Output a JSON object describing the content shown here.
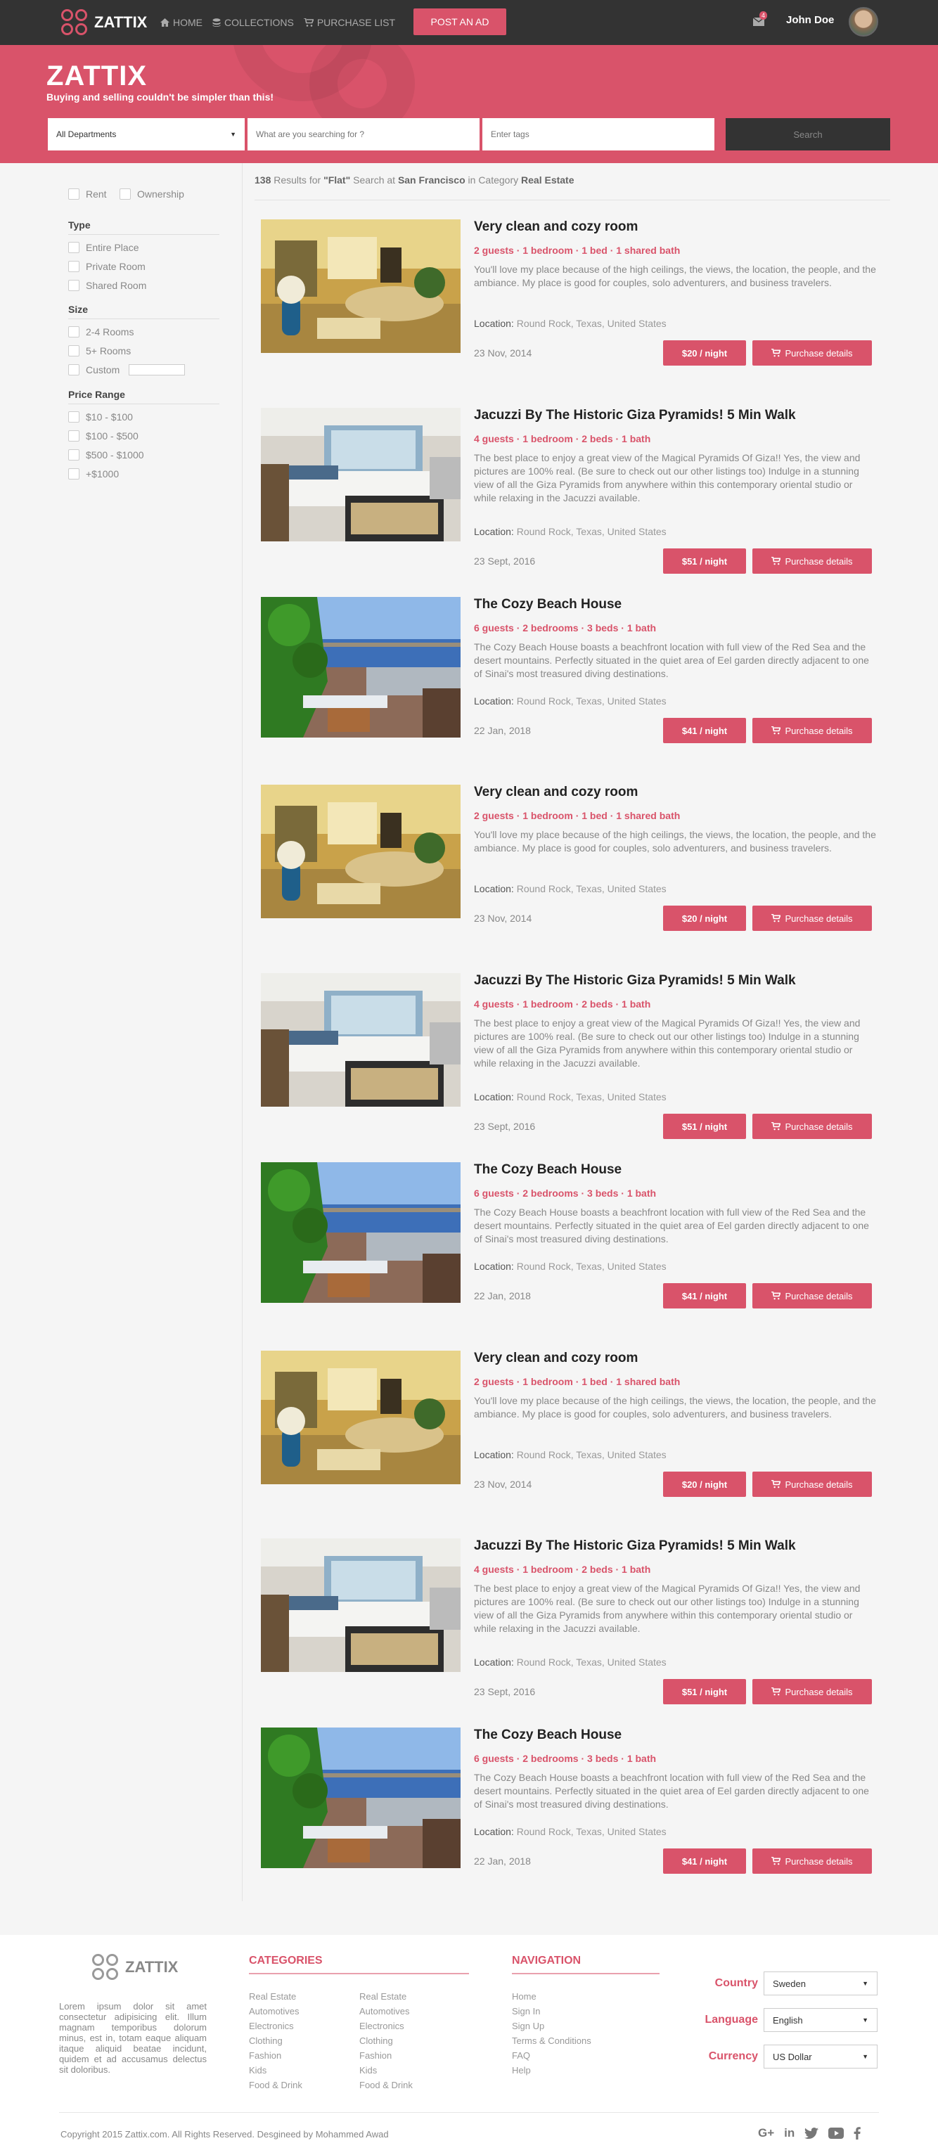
{
  "header": {
    "brand": "ZATTIX",
    "nav": [
      {
        "label": "HOME",
        "icon": "home-icon"
      },
      {
        "label": "COLLECTIONS",
        "icon": "stack-icon"
      },
      {
        "label": "PURCHASE LIST",
        "icon": "cart-icon"
      }
    ],
    "post_ad_label": "POST AN AD",
    "mail_badge": "4",
    "user_name": "John Doe"
  },
  "hero": {
    "title": "ZATTIX",
    "subtitle": "Buying and selling couldn't be simpler than this!",
    "department_value": "All Departments",
    "search_placeholder": "What are you searching for ?",
    "tags_placeholder": "Enter tags",
    "search_label": "Search"
  },
  "filters": {
    "listing": [
      "Rent",
      "Ownership"
    ],
    "type_heading": "Type",
    "types": [
      "Entire Place",
      "Private Room",
      "Shared Room"
    ],
    "size_heading": "Size",
    "sizes": [
      "2-4 Rooms",
      "5+ Rooms",
      "Custom"
    ],
    "price_heading": "Price Range",
    "prices": [
      "$10 - $100",
      "$100 - $500",
      "$500 - $1000",
      "+$1000"
    ]
  },
  "results": {
    "count": "138",
    "text1": " Results for ",
    "query": "\"Flat\"",
    "text2": " Search at ",
    "city": "San Francisco",
    "text3": " in Category ",
    "category": "Real Estate"
  },
  "listings": [
    {
      "title": "Very clean and cozy room",
      "meta": "2 guests · 1 bedroom · 1 bed · 1 shared bath",
      "desc": "You'll love my place because of the high ceilings, the views, the location, the people, and the ambiance. My place is good for couples, solo adventurers, and business travelers.",
      "location_label": "Location:",
      "location": "Round Rock, Texas, United States",
      "date": "23 Nov, 2014",
      "price": "$20 / night",
      "details_label": "Purchase details",
      "photo": "room"
    },
    {
      "title": "Jacuzzi By The Historic Giza Pyramids! 5 Min Walk",
      "meta": "4 guests · 1 bedroom · 2 beds · 1 bath",
      "desc": "The best place to enjoy a great view of the Magical Pyramids Of Giza!! Yes, the view and pictures are 100% real. (Be sure to check out our other listings too) Indulge in a stunning view of all the Giza Pyramids from anywhere within this contemporary oriental studio or while relaxing in the Jacuzzi available.",
      "location_label": "Location:",
      "location": "Round Rock, Texas, United States",
      "date": "23 Sept, 2016",
      "price": "$51 / night",
      "details_label": "Purchase details",
      "photo": "bedroom"
    },
    {
      "title": "The Cozy Beach House",
      "meta": "6 guests · 2 bedrooms · 3 beds · 1 bath",
      "desc": "The Cozy Beach House boasts a beachfront location with full view of the Red Sea and the desert mountains. Perfectly situated in the quiet area of Eel garden directly adjacent to one of Sinai's most treasured diving destinations.",
      "location_label": "Location:",
      "location": "Round Rock, Texas, United States",
      "date": "22 Jan, 2018",
      "price": "$41 / night",
      "details_label": "Purchase details",
      "photo": "beach"
    },
    {
      "title": "Very clean and cozy room",
      "meta": "2 guests · 1 bedroom · 1 bed · 1 shared bath",
      "desc": "You'll love my place because of the high ceilings, the views, the location, the people, and the ambiance. My place is good for couples, solo adventurers, and business travelers.",
      "location_label": "Location:",
      "location": "Round Rock, Texas, United States",
      "date": "23 Nov, 2014",
      "price": "$20 / night",
      "details_label": "Purchase details",
      "photo": "room"
    },
    {
      "title": "Jacuzzi By The Historic Giza Pyramids! 5 Min Walk",
      "meta": "4 guests · 1 bedroom · 2 beds · 1 bath",
      "desc": "The best place to enjoy a great view of the Magical Pyramids Of Giza!! Yes, the view and pictures are 100% real. (Be sure to check out our other listings too) Indulge in a stunning view of all the Giza Pyramids from anywhere within this contemporary oriental studio or while relaxing in the Jacuzzi available.",
      "location_label": "Location:",
      "location": "Round Rock, Texas, United States",
      "date": "23 Sept, 2016",
      "price": "$51 / night",
      "details_label": "Purchase details",
      "photo": "bedroom"
    },
    {
      "title": "The Cozy Beach House",
      "meta": "6 guests · 2 bedrooms · 3 beds · 1 bath",
      "desc": "The Cozy Beach House boasts a beachfront location with full view of the Red Sea and the desert mountains. Perfectly situated in the quiet area of Eel garden directly adjacent to one of Sinai's most treasured diving destinations.",
      "location_label": "Location:",
      "location": "Round Rock, Texas, United States",
      "date": "22 Jan, 2018",
      "price": "$41 / night",
      "details_label": "Purchase details",
      "photo": "beach"
    },
    {
      "title": "Very clean and cozy room",
      "meta": "2 guests · 1 bedroom · 1 bed · 1 shared bath",
      "desc": "You'll love my place because of the high ceilings, the views, the location, the people, and the ambiance. My place is good for couples, solo adventurers, and business travelers.",
      "location_label": "Location:",
      "location": "Round Rock, Texas, United States",
      "date": "23 Nov, 2014",
      "price": "$20 / night",
      "details_label": "Purchase details",
      "photo": "room"
    },
    {
      "title": "Jacuzzi By The Historic Giza Pyramids! 5 Min Walk",
      "meta": "4 guests · 1 bedroom · 2 beds · 1 bath",
      "desc": "The best place to enjoy a great view of the Magical Pyramids Of Giza!! Yes, the view and pictures are 100% real. (Be sure to check out our other listings too) Indulge in a stunning view of all the Giza Pyramids from anywhere within this contemporary oriental studio or while relaxing in the Jacuzzi available.",
      "location_label": "Location:",
      "location": "Round Rock, Texas, United States",
      "date": "23 Sept, 2016",
      "price": "$51 / night",
      "details_label": "Purchase details",
      "photo": "bedroom"
    },
    {
      "title": "The Cozy Beach House",
      "meta": "6 guests · 2 bedrooms · 3 beds · 1 bath",
      "desc": "The Cozy Beach House boasts a beachfront location with full view of the Red Sea and the desert mountains. Perfectly situated in the quiet area of Eel garden directly adjacent to one of Sinai's most treasured diving destinations.",
      "location_label": "Location:",
      "location": "Round Rock, Texas, United States",
      "date": "22 Jan, 2018",
      "price": "$41 / night",
      "details_label": "Purchase details",
      "photo": "beach"
    }
  ],
  "footer": {
    "brand": "ZATTIX",
    "about": "Lorem ipsum dolor sit amet consectetur adipisicing elit. Illum magnam temporibus dolorum minus, est in, totam eaque aliquam itaque aliquid beatae incidunt, quidem et ad accusamus delectus sit doloribus.",
    "categories_heading": "CATEGORIES",
    "categories_col1": [
      "Real Estate",
      "Automotives",
      "Electronics",
      "Clothing",
      "Fashion",
      "Kids",
      "Food & Drink"
    ],
    "categories_col2": [
      "Real Estate",
      "Automotives",
      "Electronics",
      "Clothing",
      "Fashion",
      "Kids",
      "Food & Drink"
    ],
    "navigation_heading": "NAVIGATION",
    "navigation": [
      "Home",
      "Sign In",
      "Sign Up",
      "Terms & Conditions",
      "FAQ",
      "Help"
    ],
    "country_label": "Country",
    "country_value": "Sweden",
    "language_label": "Language",
    "language_value": "English",
    "currency_label": "Currency",
    "currency_value": "US Dollar",
    "copyright": "Copyright 2015 Zattix.com. All Rights Reserved. Desgineed by Mohammed Awad",
    "social": [
      "google-plus-icon",
      "linkedin-icon",
      "twitter-icon",
      "youtube-icon",
      "facebook-icon"
    ]
  },
  "colors": {
    "accent": "#d9536a",
    "topbar": "#333333",
    "page": "#f5f5f5"
  }
}
